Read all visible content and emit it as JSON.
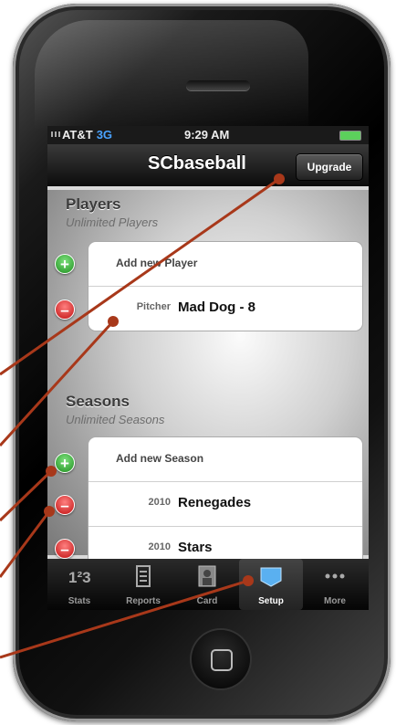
{
  "status_bar": {
    "carrier": "AT&T",
    "network": "3G",
    "time": "9:29 AM"
  },
  "nav": {
    "title": "SCbaseball",
    "upgrade_label": "Upgrade"
  },
  "players": {
    "title": "Players",
    "subtitle": "Unlimited Players",
    "add_label": "Add new Player",
    "rows": [
      {
        "key": "Pitcher",
        "value": "Mad Dog - 8"
      }
    ]
  },
  "seasons": {
    "title": "Seasons",
    "subtitle": "Unlimited Seasons",
    "add_label": "Add new Season",
    "rows": [
      {
        "key": "2010",
        "value": "Renegades"
      },
      {
        "key": "2010",
        "value": "Stars"
      }
    ]
  },
  "tabs": [
    {
      "label": "Stats",
      "icon": "numbers-icon"
    },
    {
      "label": "Reports",
      "icon": "document-icon"
    },
    {
      "label": "Card",
      "icon": "player-card-icon"
    },
    {
      "label": "Setup",
      "icon": "setup-icon",
      "selected": true
    },
    {
      "label": "More",
      "icon": "more-dots-icon"
    }
  ],
  "colors": {
    "callout_line": "#a8381a",
    "plus": "#1f8f1f",
    "minus": "#c01010",
    "network": "#4aa3ff"
  }
}
